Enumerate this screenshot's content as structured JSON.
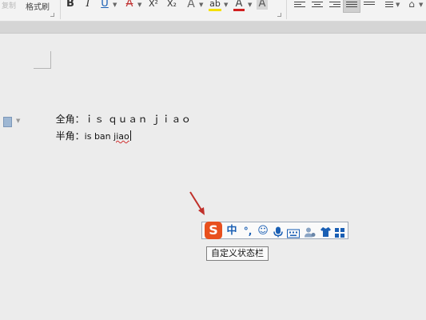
{
  "ribbon": {
    "copy_label": "复制",
    "format_painter_label": "格式刷",
    "bold_label": "B",
    "italic_label": "I",
    "underline_label": "U",
    "strikethrough_label": "A",
    "superscript_label": "X²",
    "subscript_label": "X₂",
    "text_effect_label": "A",
    "highlight_label": "ab",
    "font_color_label": "A",
    "char_shading_label": "A"
  },
  "document": {
    "line1_label": "全角：",
    "line1_text": "ｉｓ ｑｕａｎ ｊｉａｏ",
    "line2_label": "半角：",
    "line2_text_plain": "is ban ",
    "line2_text_misspelled": "jiao"
  },
  "ime": {
    "mode_label": "中",
    "punct_label": "°,",
    "tooltip": "自定义状态栏"
  },
  "colors": {
    "ime_logo": "#e8501e",
    "ime_icons": "#1a5fb4",
    "arrow": "#c0302a",
    "highlight_yellow": "#f5e000",
    "font_color_red": "#d02020"
  }
}
